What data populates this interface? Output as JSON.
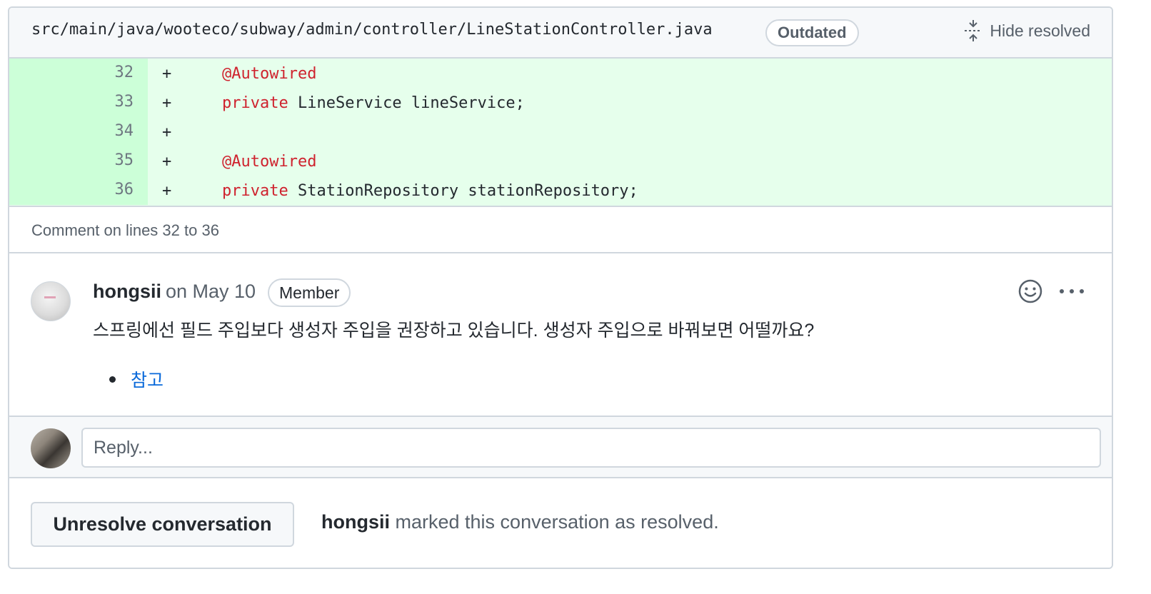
{
  "file": {
    "path": "src/main/java/wooteco/subway/admin/controller/LineStationController.java",
    "outdated_label": "Outdated",
    "hide_resolved_label": "Hide resolved"
  },
  "code": {
    "lines": [
      {
        "number": "32",
        "sign": "+",
        "keyword": "@Autowired",
        "rest": ""
      },
      {
        "number": "33",
        "sign": "+",
        "keyword": "private",
        "rest": " LineService lineService;"
      },
      {
        "number": "34",
        "sign": "+",
        "keyword": "",
        "rest": ""
      },
      {
        "number": "35",
        "sign": "+",
        "keyword": "@Autowired",
        "rest": ""
      },
      {
        "number": "36",
        "sign": "+",
        "keyword": "private",
        "rest": " StationRepository stationRepository;"
      }
    ]
  },
  "comment_meta": "Comment on lines 32 to 36",
  "comment": {
    "author": "hongsii",
    "date": "on May 10",
    "role_badge": "Member",
    "body": "스프링에선 필드 주입보다 생성자 주입을 권장하고 있습니다. 생성자 주입으로 바꿔보면 어떨까요?",
    "links": [
      "참고"
    ]
  },
  "reply": {
    "placeholder": "Reply..."
  },
  "footer": {
    "unresolve_label": "Unresolve conversation",
    "resolver": "hongsii",
    "resolved_text": " marked this conversation as resolved."
  },
  "colors": {
    "added_bg": "#e6ffec",
    "added_gutter": "#ccffd8",
    "keyword": "#cf222e",
    "link": "#0969da",
    "border": "#d0d7de"
  }
}
